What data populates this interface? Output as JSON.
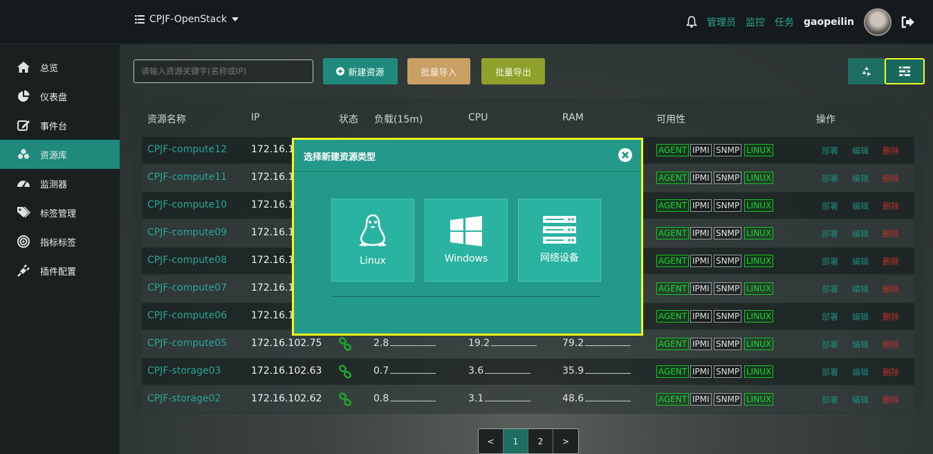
{
  "header": {
    "project": "CPJF-OpenStack",
    "links": [
      "管理员",
      "监控",
      "任务"
    ],
    "username": "gaopeilin"
  },
  "sidebar": {
    "items": [
      {
        "label": "总览",
        "icon": "home-icon"
      },
      {
        "label": "仪表盘",
        "icon": "pie-chart-icon"
      },
      {
        "label": "事件台",
        "icon": "edit-icon"
      },
      {
        "label": "资源库",
        "icon": "cubes-icon",
        "active": true
      },
      {
        "label": "监测器",
        "icon": "dashboard-icon"
      },
      {
        "label": "标签管理",
        "icon": "tags-icon"
      },
      {
        "label": "指标标签",
        "icon": "target-icon"
      },
      {
        "label": "插件配置",
        "icon": "plug-icon"
      }
    ]
  },
  "toolbar": {
    "search_placeholder": "请输入资源关键字(名称或IP)",
    "new_label": "新建资源",
    "import_label": "批量导入",
    "export_label": "批量导出"
  },
  "table": {
    "headers": [
      "资源名称",
      "IP",
      "状态",
      "负载(15m)",
      "CPU",
      "RAM",
      "可用性",
      "操作"
    ],
    "tags": [
      "AGENT",
      "IPMI",
      "SNMP",
      "LINUX"
    ],
    "actions": [
      "部署",
      "编辑",
      "删除"
    ],
    "rows": [
      {
        "name": "CPJF-compute12",
        "ip": "172.16.1",
        "load": "",
        "cpu": "",
        "ram": ""
      },
      {
        "name": "CPJF-compute11",
        "ip": "172.16.1",
        "load": "",
        "cpu": "",
        "ram": ""
      },
      {
        "name": "CPJF-compute10",
        "ip": "172.16.1",
        "load": "",
        "cpu": "",
        "ram": ""
      },
      {
        "name": "CPJF-compute09",
        "ip": "172.16.1",
        "load": "",
        "cpu": "",
        "ram": ""
      },
      {
        "name": "CPJF-compute08",
        "ip": "172.16.1",
        "load": "",
        "cpu": "",
        "ram": ""
      },
      {
        "name": "CPJF-compute07",
        "ip": "172.16.1",
        "load": "",
        "cpu": "",
        "ram": ""
      },
      {
        "name": "CPJF-compute06",
        "ip": "172.16.1",
        "load": "",
        "cpu": "",
        "ram": ""
      },
      {
        "name": "CPJF-compute05",
        "ip": "172.16.102.75",
        "load": "2.8",
        "cpu": "19.2",
        "ram": "79.2"
      },
      {
        "name": "CPJF-storage03",
        "ip": "172.16.102.63",
        "load": "0.7",
        "cpu": "3.6",
        "ram": "35.9"
      },
      {
        "name": "CPJF-storage02",
        "ip": "172.16.102.62",
        "load": "0.8",
        "cpu": "3.1",
        "ram": "48.6"
      }
    ]
  },
  "pagination": {
    "prev": "<",
    "pages": [
      "1",
      "2"
    ],
    "next": ">",
    "current": "1"
  },
  "modal": {
    "title": "选择新建资源类型",
    "options": [
      {
        "label": "Linux",
        "icon": "linux-icon"
      },
      {
        "label": "Windows",
        "icon": "windows-icon"
      },
      {
        "label": "网络设备",
        "icon": "server-icon"
      }
    ]
  },
  "colors": {
    "accent": "#1f8a7c",
    "highlight": "#f1ff1f",
    "danger": "#c2312b",
    "import": "#c9a063",
    "export": "#8fa12b"
  }
}
